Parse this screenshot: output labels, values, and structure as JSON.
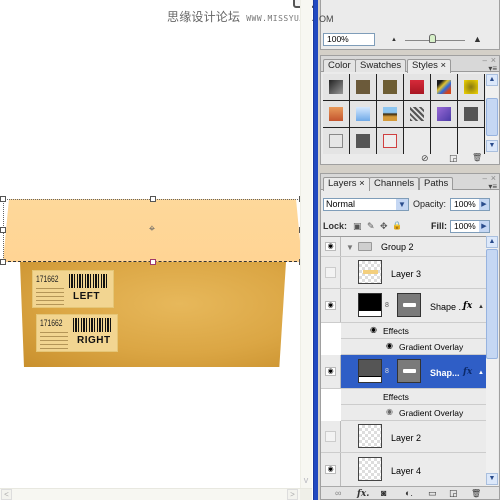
{
  "watermark": {
    "cn": "思缘设计论坛",
    "url": "WWW.MISSYUAN.COM"
  },
  "canvas": {
    "labels": [
      {
        "number": "171662",
        "word": "LEFT"
      },
      {
        "number": "171662",
        "word": "RIGHT"
      }
    ],
    "transform_center_glyph": "⌖",
    "scroll_left": "<",
    "scroll_right": ">",
    "scroll_down": "v"
  },
  "navigator": {
    "label": "OM",
    "zoom_value": "100%",
    "zoom_out_icon": "▲",
    "zoom_in_icon": "▲",
    "zoom_slider_fraction": 0.45
  },
  "styles_panel": {
    "tabs": [
      {
        "label": "Color",
        "active": false
      },
      {
        "label": "Swatches",
        "active": false
      },
      {
        "label": "Styles ×",
        "active": true
      }
    ],
    "minimize": "–",
    "close": "×",
    "menu": "▾≡",
    "swatches": [
      {
        "name": "gradient-dark",
        "bg": "linear-gradient(135deg,#222,#999)"
      },
      {
        "name": "brown",
        "bg": "#6b5a3a"
      },
      {
        "name": "olive-brown",
        "bg": "#6e5e34"
      },
      {
        "name": "red-stripes",
        "bg": "linear-gradient(180deg,#d62a3a,#a81622)"
      },
      {
        "name": "multicolor",
        "bg": "linear-gradient(135deg,#1a1a1a 20%,#e3c530 40%,#2a6ae0 60%,#d1451d 80%)"
      },
      {
        "name": "gold-frame",
        "bg": "radial-gradient(#8a7a10,#f1d400)"
      },
      {
        "name": "orange-sunset",
        "bg": "linear-gradient(180deg,#e89a5a,#c4552e)"
      },
      {
        "name": "sky-blue",
        "bg": "linear-gradient(180deg,#d6e9ff,#6faae8)"
      },
      {
        "name": "landscape",
        "bg": "linear-gradient(180deg,#8ec6f0 40%,#3a2a10 50%,#d49a3a 70%)"
      },
      {
        "name": "pattern-gray",
        "bg": "repeating-linear-gradient(45deg,#555 0 2px,#ddd 2px 4px)"
      },
      {
        "name": "purple",
        "bg": "linear-gradient(135deg,#9a6ad6,#4a3aa6)"
      },
      {
        "name": "dark-gray",
        "bg": "#555555"
      },
      {
        "name": "light-gray-outline",
        "bg": "#e6e6e6",
        "border": "#888"
      },
      {
        "name": "charcoal",
        "bg": "#555555"
      },
      {
        "name": "red-outline",
        "bg": "#eeeeee",
        "border": "#d04040"
      }
    ],
    "footer_icons": [
      "⊘",
      "◲",
      "🗑"
    ]
  },
  "layers_panel": {
    "tabs": [
      {
        "label": "Layers ×",
        "active": true
      },
      {
        "label": "Channels",
        "active": false
      },
      {
        "label": "Paths",
        "active": false
      }
    ],
    "minimize": "–",
    "close": "×",
    "menu": "▾≡",
    "blend_mode": "Normal",
    "opacity_label": "Opacity:",
    "opacity_value": "100%",
    "lock_label": "Lock:",
    "fill_label": "Fill:",
    "fill_value": "100%",
    "lock_icons": [
      "▣",
      "✎",
      "✥",
      "🔒"
    ],
    "group": {
      "name": "Group 2",
      "expanded": true,
      "visible": true
    },
    "layers": [
      {
        "name": "Layer 3",
        "visible": false
      },
      {
        "name": "Shape ...",
        "visible": true,
        "selected": false,
        "fx": "fx",
        "effects_label": "Effects",
        "effect": "Gradient Overlay"
      },
      {
        "name": "Shap...",
        "visible": true,
        "selected": true,
        "fx": "fx",
        "effects_label": "Effects",
        "effect": "Gradient Overlay"
      },
      {
        "name": "Layer 2",
        "visible": false
      },
      {
        "name": "Layer 4",
        "visible": true
      }
    ],
    "footer_icons": [
      "∞",
      "fx.",
      "◙",
      "◐.",
      "▭",
      "◲",
      "🗑"
    ]
  },
  "colors": {
    "selection_blue": "#2f5ec6",
    "dock_divider": "#2149c1",
    "shape_fill": "#fed89a",
    "box_tan": "#dba644"
  }
}
